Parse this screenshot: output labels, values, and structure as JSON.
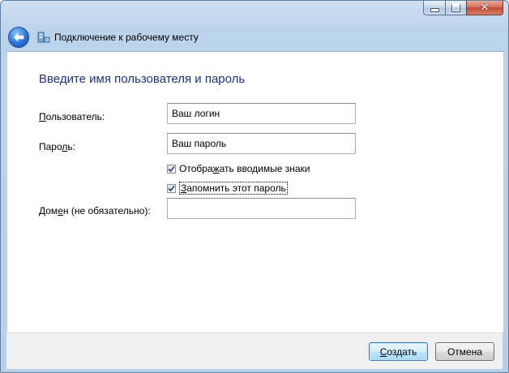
{
  "window": {
    "title": "Подключение к рабочему месту",
    "caption_buttons": {
      "minimize": "minimize",
      "maximize": "maximize",
      "close": "✕"
    }
  },
  "page": {
    "heading": "Введите имя пользователя и пароль"
  },
  "form": {
    "username": {
      "label_underlined": "П",
      "label_rest": "ользователь:",
      "value": "Ваш логин"
    },
    "password": {
      "label_pre": "Паро",
      "label_underlined": "л",
      "label_rest": "ь:",
      "value": "Ваш пароль"
    },
    "show_chars": {
      "label_pre": "Отобра",
      "label_underlined": "ж",
      "label_rest": "ать вводимые знаки",
      "checked": true
    },
    "remember": {
      "label_underlined": "З",
      "label_rest": "апомнить этот пароль",
      "checked": true
    },
    "domain": {
      "label_pre": "Дом",
      "label_underlined": "е",
      "label_rest": "н (не обязательно):",
      "value": ""
    }
  },
  "footer": {
    "create_button": {
      "label_underlined": "С",
      "label_rest": "оздать"
    },
    "cancel_button": {
      "label": "Отмена"
    }
  },
  "colors": {
    "heading": "#1e3287",
    "accent": "#2d74d8"
  },
  "icons": {
    "back": "back-arrow-icon",
    "network": "network-connection-icon",
    "check": "checkmark-icon"
  }
}
